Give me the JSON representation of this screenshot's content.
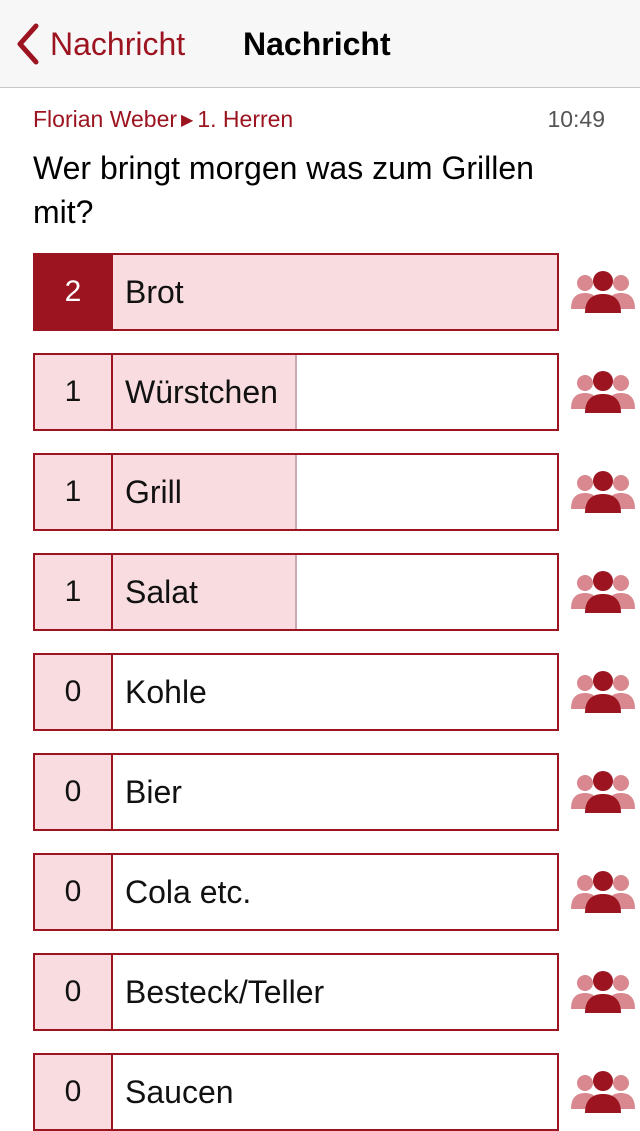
{
  "nav": {
    "back_label": "Nachricht",
    "title": "Nachricht"
  },
  "message": {
    "sender": "Florian Weber",
    "group": "1. Herren",
    "time": "10:49",
    "question": "Wer bringt morgen was zum Grillen mit?"
  },
  "poll": {
    "options": [
      {
        "count": "2",
        "label": "Brot",
        "fraction": 1.0
      },
      {
        "count": "1",
        "label": "Würstchen",
        "fraction": 0.5
      },
      {
        "count": "1",
        "label": "Grill",
        "fraction": 0.5
      },
      {
        "count": "1",
        "label": "Salat",
        "fraction": 0.5
      },
      {
        "count": "0",
        "label": "Kohle",
        "fraction": 0
      },
      {
        "count": "0",
        "label": "Bier",
        "fraction": 0
      },
      {
        "count": "0",
        "label": "Cola etc.",
        "fraction": 0
      },
      {
        "count": "0",
        "label": "Besteck/Teller",
        "fraction": 0
      },
      {
        "count": "0",
        "label": "Saucen",
        "fraction": 0
      }
    ]
  },
  "colors": {
    "accent": "#9b1420",
    "fill": "#f8dcdf",
    "icon_light": "#d9888f"
  }
}
